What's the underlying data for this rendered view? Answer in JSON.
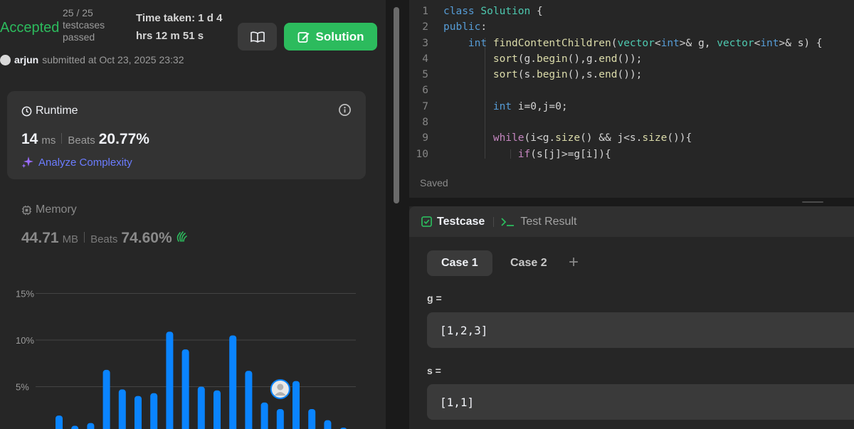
{
  "submission": {
    "status": "Accepted",
    "testcases_line1": "25 / 25",
    "testcases_line2": "testcases",
    "testcases_line3": "passed",
    "time_line1": "Time taken: 1 d 4",
    "time_line2": "hrs 12 m 51 s",
    "solution_label": "Solution",
    "user": "arjun",
    "submitted_text": "submitted at Oct 23, 2025 23:32"
  },
  "runtime": {
    "title": "Runtime",
    "value": "14",
    "unit": "ms",
    "beats_label": "Beats",
    "beats_value": "20.77%",
    "analyze_label": "Analyze Complexity"
  },
  "memory": {
    "title": "Memory",
    "value": "44.71",
    "unit": "MB",
    "beats_label": "Beats",
    "beats_value": "74.60%"
  },
  "chart_data": {
    "type": "bar",
    "ytick_labels": [
      "15%",
      "10%",
      "5%"
    ],
    "ylim": [
      0,
      15
    ],
    "values": [
      1.9,
      0.8,
      1.1,
      6.8,
      4.7,
      4.0,
      4.3,
      10.9,
      9.0,
      5.0,
      4.6,
      10.5,
      6.7,
      3.3,
      2.6,
      5.6,
      2.6,
      1.4,
      0.6
    ],
    "highlight_index": 14,
    "color": "#0a84ff",
    "grid": true
  },
  "editor": {
    "saved_label": "Saved",
    "lines": [
      {
        "n": "1",
        "html": "<span class=\"kw\">class</span> <span class=\"ty\">Solution</span> {"
      },
      {
        "n": "2",
        "html": "<span class=\"kw\">public</span>:"
      },
      {
        "n": "3",
        "html": "    <span class=\"kw\">int</span> <span class=\"fn\">findContentChildren</span>(<span class=\"ty\">vector</span>&lt;<span class=\"kw\">int</span>&gt;&amp; g, <span class=\"ty\">vector</span>&lt;<span class=\"kw\">int</span>&gt;&amp; s) {"
      },
      {
        "n": "4",
        "html": "        <span class=\"fn\">sort</span>(g.<span class=\"fn\">begin</span>(),g.<span class=\"fn\">end</span>());"
      },
      {
        "n": "5",
        "html": "        <span class=\"fn\">sort</span>(s.<span class=\"fn\">begin</span>(),s.<span class=\"fn\">end</span>());"
      },
      {
        "n": "6",
        "html": ""
      },
      {
        "n": "7",
        "html": "        <span class=\"kw\">int</span> i=0,j=0;"
      },
      {
        "n": "8",
        "html": ""
      },
      {
        "n": "9",
        "html": "        <span class=\"kc\">while</span>(i&lt;g.<span class=\"fn\">size</span>() &amp;&amp; j&lt;s.<span class=\"fn\">size</span>()){"
      },
      {
        "n": "10",
        "html": "            <span class=\"kc\">if</span>(s[j]&gt;=g[i]){"
      }
    ]
  },
  "testcase": {
    "tab_testcase": "Testcase",
    "tab_result": "Test Result",
    "case1": "Case 1",
    "case2": "Case 2",
    "var1_label": "g =",
    "var1_value": "[1,2,3]",
    "var2_label": "s =",
    "var2_value": "[1,1]"
  }
}
